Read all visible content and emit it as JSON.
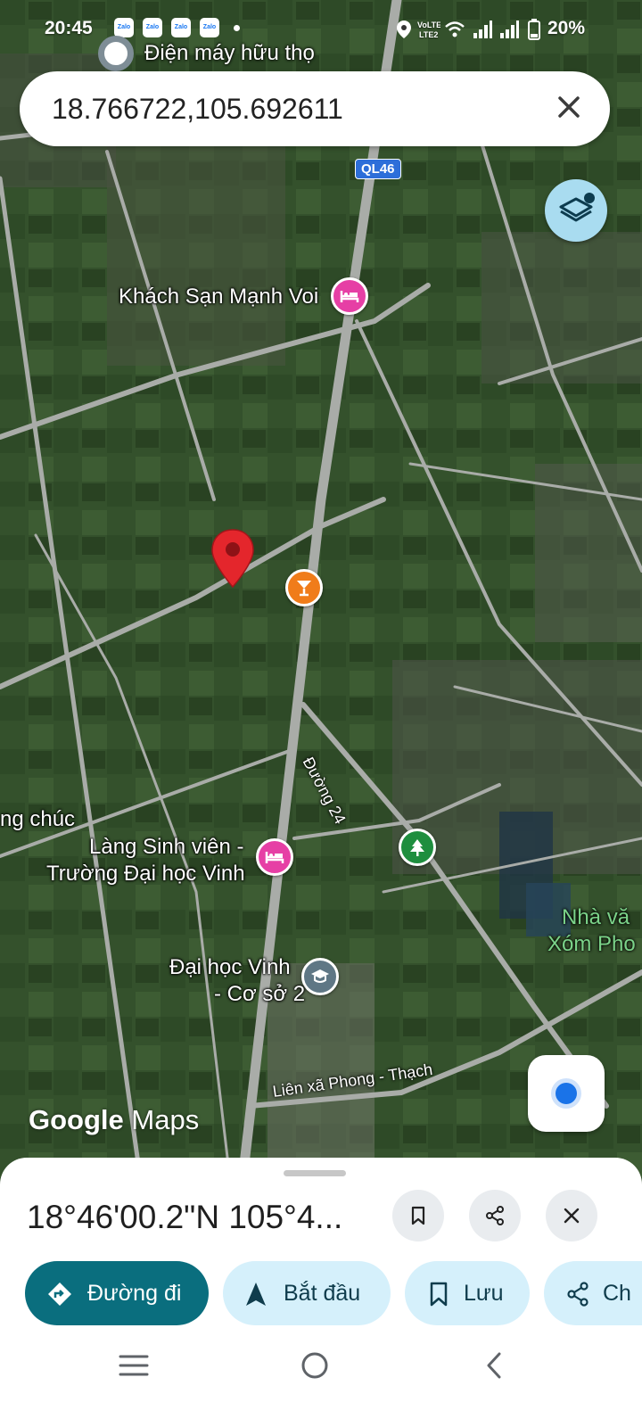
{
  "status_bar": {
    "time": "20:45",
    "notification_apps": [
      "Zalo",
      "Zalo",
      "Zalo",
      "Zalo"
    ],
    "battery": "20%",
    "icons": [
      "location-icon",
      "volte-icon",
      "wifi-icon",
      "signal-icon",
      "signal-icon",
      "battery-icon"
    ]
  },
  "place_hint": "Điện máy hữu thọ",
  "search": {
    "query": "18.766722,105.692611"
  },
  "map": {
    "route_shield": "QL46",
    "labels": {
      "hotel_1": "Khách Sạn Mạnh Voi",
      "left_edge": "ng chúc",
      "dorm_line1": "Làng Sinh viên -",
      "dorm_line2": "Trường Đại học Vinh",
      "uni_line1": "Đại học Vinh",
      "uni_line2": "- Cơ sở 2",
      "right_line1": "Nhà vă",
      "right_line2": "Xóm Pho"
    },
    "roads": {
      "duong24": "Đường 24",
      "lienxa": "Liên xã Phong - Thạch"
    },
    "logo": {
      "google": "Google",
      "maps": "Maps"
    },
    "poi_colors": {
      "hotel": "#e63fa5",
      "bar": "#f07c1a",
      "park": "#1e8e3e",
      "school": "#5f7785",
      "pin": "#e4262c"
    }
  },
  "sheet": {
    "coordinates": "18°46'00.2\"N 105°4...",
    "actions": {
      "directions": "Đường đi",
      "start": "Bắt đầu",
      "save": "Lưu",
      "share": "Ch"
    }
  }
}
